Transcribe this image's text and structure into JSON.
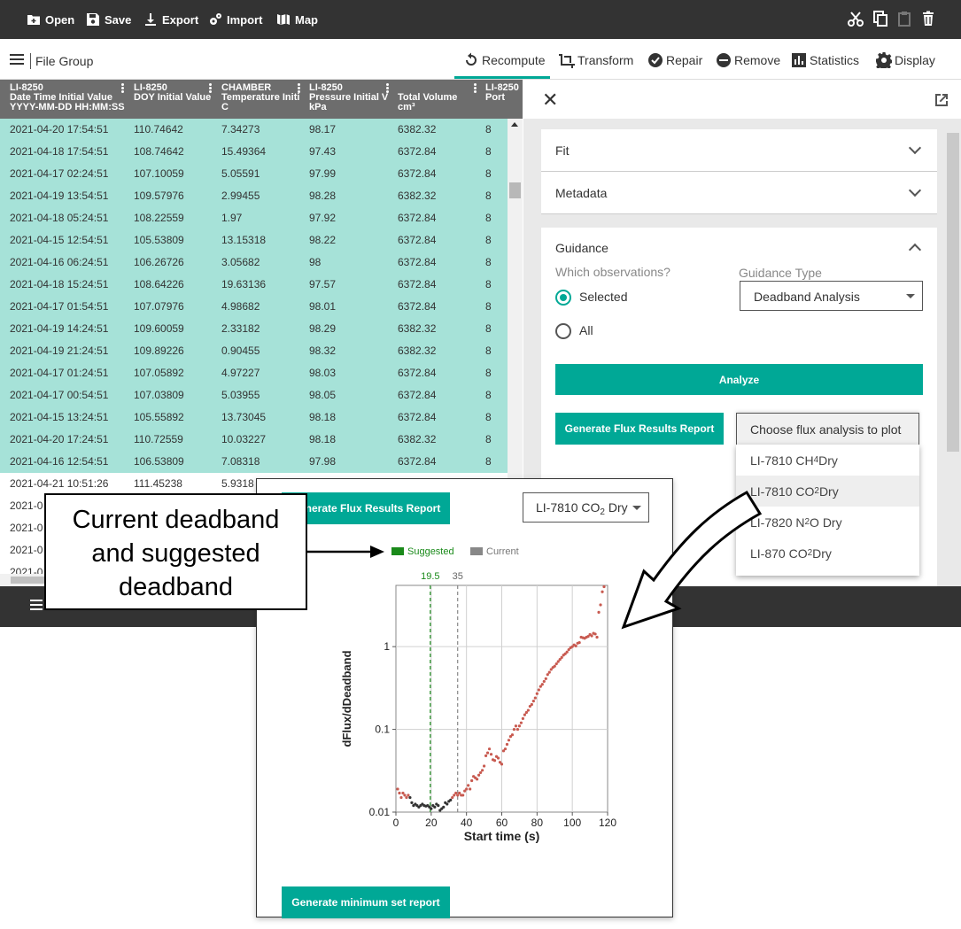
{
  "toolbar": {
    "open": "Open",
    "save": "Save",
    "export": "Export",
    "import": "Import",
    "map": "Map"
  },
  "subbar": {
    "file_group": "File Group",
    "actions": [
      "Recompute",
      "Transform",
      "Repair",
      "Remove",
      "Statistics",
      "Display"
    ]
  },
  "table": {
    "columns": [
      [
        "LI-8250",
        "Date Time Initial Value",
        "YYYY-MM-DD HH:MM:SS"
      ],
      [
        "LI-8250",
        "DOY Initial Value",
        ""
      ],
      [
        "CHAMBER",
        "Temperature Initi",
        "C"
      ],
      [
        "LI-8250",
        "Pressure Initial V",
        "kPa"
      ],
      [
        "",
        "Total Volume",
        "cm³"
      ],
      [
        "LI-8250",
        "Port",
        ""
      ]
    ],
    "rows": [
      [
        "2021-04-20 17:54:51",
        "110.74642",
        "7.34273",
        "98.17",
        "6382.32",
        "8"
      ],
      [
        "2021-04-18 17:54:51",
        "108.74642",
        "15.49364",
        "97.43",
        "6372.84",
        "8"
      ],
      [
        "2021-04-17 02:24:51",
        "107.10059",
        "5.05591",
        "97.99",
        "6372.84",
        "8"
      ],
      [
        "2021-04-19 13:54:51",
        "109.57976",
        "2.99455",
        "98.28",
        "6382.32",
        "8"
      ],
      [
        "2021-04-18 05:24:51",
        "108.22559",
        "1.97",
        "97.92",
        "6372.84",
        "8"
      ],
      [
        "2021-04-15 12:54:51",
        "105.53809",
        "13.15318",
        "98.22",
        "6372.84",
        "8"
      ],
      [
        "2021-04-16 06:24:51",
        "106.26726",
        "3.05682",
        "98",
        "6372.84",
        "8"
      ],
      [
        "2021-04-18 15:24:51",
        "108.64226",
        "19.63136",
        "97.57",
        "6372.84",
        "8"
      ],
      [
        "2021-04-17 01:54:51",
        "107.07976",
        "4.98682",
        "98.01",
        "6372.84",
        "8"
      ],
      [
        "2021-04-19 14:24:51",
        "109.60059",
        "2.33182",
        "98.29",
        "6382.32",
        "8"
      ],
      [
        "2021-04-19 21:24:51",
        "109.89226",
        "0.90455",
        "98.32",
        "6382.32",
        "8"
      ],
      [
        "2021-04-17 01:24:51",
        "107.05892",
        "4.97227",
        "98.03",
        "6372.84",
        "8"
      ],
      [
        "2021-04-17 00:54:51",
        "107.03809",
        "5.03955",
        "98.05",
        "6372.84",
        "8"
      ],
      [
        "2021-04-15 13:24:51",
        "105.55892",
        "13.73045",
        "98.18",
        "6372.84",
        "8"
      ],
      [
        "2021-04-20 17:24:51",
        "110.72559",
        "10.03227",
        "98.18",
        "6382.32",
        "8"
      ],
      [
        "2021-04-16 12:54:51",
        "106.53809",
        "7.08318",
        "97.98",
        "6372.84",
        "8"
      ],
      [
        "2021-04-21 10:51:26",
        "111.45238",
        "5.9318",
        "",
        "",
        ""
      ],
      [
        "2021-0",
        "",
        "",
        "",
        "",
        ""
      ],
      [
        "2021-0",
        "",
        "",
        "",
        "",
        ""
      ],
      [
        "2021-0",
        "",
        "",
        "",
        "",
        ""
      ],
      [
        "2021-0",
        "",
        "",
        "",
        "",
        ""
      ]
    ],
    "selected_count": 16
  },
  "panel": {
    "fit": "Fit",
    "metadata": "Metadata",
    "guidance": "Guidance",
    "which_obs": "Which observations?",
    "guidance_type_label": "Guidance Type",
    "guidance_type_value": "Deadband Analysis",
    "selected": "Selected",
    "all": "All",
    "analyze": "Analyze",
    "generate_flux": "Generate Flux Results Report",
    "choose_placeholder": "Choose flux analysis to plot",
    "menu_items": [
      {
        "pre": "LI-7810 CH",
        "sub": "4",
        "post": " Dry"
      },
      {
        "pre": "LI-7810 CO",
        "sub": "2",
        "post": " Dry"
      },
      {
        "pre": "LI-7820 N",
        "sub": "2",
        "post": "O Dry"
      },
      {
        "pre": "LI-870 CO",
        "sub": "2",
        "post": " Dry"
      }
    ]
  },
  "popup": {
    "generate_flux": "Generate Flux Results Report",
    "analysis_select": {
      "pre": "LI-7810 CO",
      "sub": "2",
      "post": " Dry"
    },
    "legend_suggested": "Suggested",
    "legend_current": "Current",
    "generate_min": "Generate minimum set report"
  },
  "callout": {
    "lines": [
      "Current deadband",
      "and suggested",
      "deadband"
    ]
  },
  "chart_data": {
    "type": "scatter",
    "xlabel": "Start time (s)",
    "ylabel": "dFlux/dDeadband",
    "xlim": [
      0,
      120
    ],
    "xticks": [
      0,
      20,
      40,
      60,
      80,
      100,
      120
    ],
    "ylim": [
      0.01,
      5.5
    ],
    "yscale": "log",
    "yticks": [
      0.01,
      0.1,
      1
    ],
    "ytick_labels": [
      "0.01",
      "0.1",
      "1"
    ],
    "grid": true,
    "legend": "top-center",
    "colors": {
      "suggested": "#1a8a1a",
      "current": "#888888",
      "points": "#c85a50",
      "points_in_deadband": "#333333"
    },
    "vlines": [
      {
        "name": "Suggested",
        "x": 19.5,
        "label": "19.5"
      },
      {
        "name": "Current",
        "x": 35,
        "label": "35"
      }
    ],
    "series": [
      {
        "name": "",
        "points": [
          [
            1,
            0.019
          ],
          [
            2,
            0.017
          ],
          [
            3,
            0.015
          ],
          [
            4,
            0.017
          ],
          [
            5,
            0.016
          ],
          [
            6,
            0.015
          ],
          [
            7,
            0.016
          ],
          [
            8,
            0.015
          ],
          [
            9,
            0.013
          ],
          [
            10,
            0.012
          ],
          [
            11,
            0.0125
          ],
          [
            12,
            0.012
          ],
          [
            13,
            0.0115
          ],
          [
            14,
            0.012
          ],
          [
            15,
            0.0125
          ],
          [
            16,
            0.012
          ],
          [
            17,
            0.0118
          ],
          [
            18,
            0.012
          ],
          [
            19,
            0.0115
          ],
          [
            20,
            0.011
          ],
          [
            21,
            0.012
          ],
          [
            22,
            0.0115
          ],
          [
            23,
            0.0125
          ],
          [
            24,
            0.012
          ],
          [
            25,
            0.0105
          ],
          [
            26,
            0.011
          ],
          [
            27,
            0.0115
          ],
          [
            28,
            0.013
          ],
          [
            29,
            0.0125
          ],
          [
            30,
            0.0135
          ],
          [
            31,
            0.014
          ],
          [
            32,
            0.015
          ],
          [
            33,
            0.016
          ],
          [
            34,
            0.017
          ],
          [
            35,
            0.016
          ],
          [
            36,
            0.017
          ],
          [
            37,
            0.016
          ],
          [
            38,
            0.016
          ],
          [
            39,
            0.018
          ],
          [
            40,
            0.019
          ],
          [
            41,
            0.021
          ],
          [
            42,
            0.019
          ],
          [
            43,
            0.024
          ],
          [
            44,
            0.027
          ],
          [
            45,
            0.026
          ],
          [
            46,
            0.025
          ],
          [
            47,
            0.028
          ],
          [
            48,
            0.03
          ],
          [
            49,
            0.032
          ],
          [
            50,
            0.036
          ],
          [
            51,
            0.048
          ],
          [
            52,
            0.052
          ],
          [
            53,
            0.058
          ],
          [
            54,
            0.05
          ],
          [
            55,
            0.043
          ],
          [
            56,
            0.042
          ],
          [
            57,
            0.047
          ],
          [
            58,
            0.045
          ],
          [
            59,
            0.04
          ],
          [
            60,
            0.038
          ],
          [
            61,
            0.055
          ],
          [
            62,
            0.058
          ],
          [
            63,
            0.066
          ],
          [
            64,
            0.074
          ],
          [
            65,
            0.082
          ],
          [
            66,
            0.086
          ],
          [
            67,
            0.1
          ],
          [
            68,
            0.11
          ],
          [
            69,
            0.1
          ],
          [
            70,
            0.11
          ],
          [
            71,
            0.12
          ],
          [
            72,
            0.135
          ],
          [
            73,
            0.15
          ],
          [
            74,
            0.16
          ],
          [
            75,
            0.17
          ],
          [
            76,
            0.19
          ],
          [
            77,
            0.2
          ],
          [
            78,
            0.22
          ],
          [
            79,
            0.24
          ],
          [
            80,
            0.27
          ],
          [
            81,
            0.3
          ],
          [
            82,
            0.33
          ],
          [
            83,
            0.35
          ],
          [
            84,
            0.38
          ],
          [
            85,
            0.41
          ],
          [
            86,
            0.46
          ],
          [
            87,
            0.49
          ],
          [
            88,
            0.53
          ],
          [
            89,
            0.56
          ],
          [
            90,
            0.58
          ],
          [
            91,
            0.62
          ],
          [
            92,
            0.66
          ],
          [
            93,
            0.7
          ],
          [
            94,
            0.74
          ],
          [
            95,
            0.79
          ],
          [
            96,
            0.82
          ],
          [
            97,
            0.86
          ],
          [
            98,
            0.92
          ],
          [
            99,
            0.97
          ],
          [
            100,
            1.0
          ],
          [
            101,
            1.05
          ],
          [
            102,
            1.02
          ],
          [
            103,
            1.1
          ],
          [
            104,
            1.12
          ],
          [
            105,
            1.3
          ],
          [
            106,
            1.28
          ],
          [
            107,
            1.26
          ],
          [
            108,
            1.3
          ],
          [
            109,
            1.33
          ],
          [
            110,
            1.4
          ],
          [
            111,
            1.35
          ],
          [
            112,
            1.45
          ],
          [
            113,
            1.42
          ],
          [
            114,
            1.3
          ],
          [
            115,
            2.6
          ],
          [
            116,
            3.2
          ],
          [
            117,
            4.6
          ],
          [
            118,
            5.3
          ]
        ]
      }
    ]
  }
}
